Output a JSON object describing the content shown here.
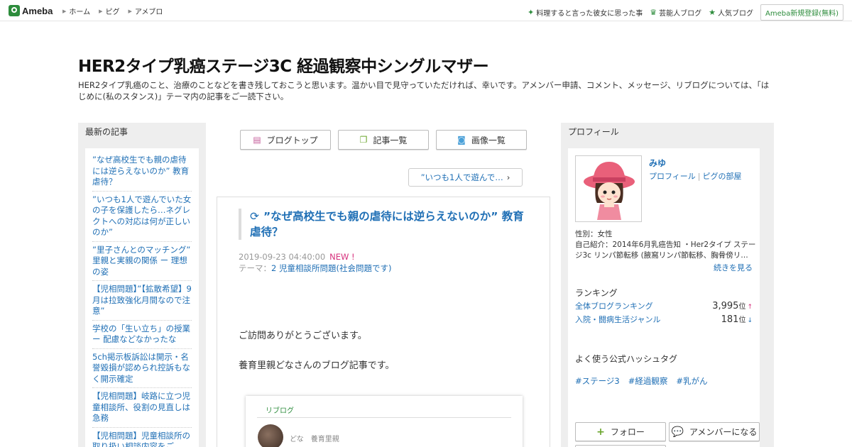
{
  "topbar": {
    "logo": "Ameba",
    "nav": [
      "ホーム",
      "ピグ",
      "アメブロ"
    ],
    "right_links": [
      {
        "icon": "sparkle-icon",
        "label": "料理すると言った彼女に思った事"
      },
      {
        "icon": "crown-icon",
        "label": "芸能人ブログ"
      },
      {
        "icon": "star-icon",
        "label": "人気ブログ"
      }
    ],
    "register": "Ameba新規登録(無料)"
  },
  "header": {
    "title": "HER2タイプ乳癌ステージ3C 経過観察中シングルマザー",
    "description": "HER2タイプ乳癌のこと、治療のことなどを書き残しておこうと思います。温かい目で見守っていただければ、幸いです。アメンバー申請、コメント、メッセージ、リブログについては、「はじめに(私のスタンス)」テーマ内の記事をご一読下さい。"
  },
  "left": {
    "heading": "最新の記事",
    "items": [
      "”なぜ高校生でも親の虐待には逆らえないのか” 教育虐待？",
      "”いつも1人で遊んでいた女の子を保護したら…ネグレクトへの対応は何が正しいのか”",
      "”里子さんとのマッチング” 里親と実親の関係 ー 理想の姿",
      "【児相問題】”【拡散希望】9月は拉致強化月間なので注意”",
      "学校の「生い立ち」の授業 ー 配慮などなかったな",
      "5ch掲示板訴訟は開示・名誉毀損が認められ控訴もなく開示確定",
      "【児相問題】岐路に立つ児童相談所、役割の見直しは急務",
      "【児相問題】児童相談所の取り扱い相談内容をご"
    ]
  },
  "center": {
    "nav_buttons": [
      {
        "icon": "document-icon",
        "label": "ブログトップ"
      },
      {
        "icon": "list-icon",
        "label": "記事一覧"
      },
      {
        "icon": "camera-icon",
        "label": "画像一覧"
      }
    ],
    "next_article": "”いつも1人で遊んで…",
    "article": {
      "title": "”なぜ高校生でも親の虐待には逆らえないのか” 教育虐待？",
      "date": "2019-09-23 04:40:00",
      "new_badge": "NEW !",
      "theme_label": "テーマ：",
      "theme": "2 児童相談所問題(社会問題です)",
      "paragraphs": [
        "ご訪問ありがとうございます。",
        "養育里親どなさんのブログ記事です。"
      ],
      "reblog_label": "リブログ",
      "reblog_author": "どな　養育里親"
    }
  },
  "right": {
    "heading": "プロフィール",
    "name": "みゆ",
    "links": [
      "プロフィール",
      "ピグの部屋"
    ],
    "link_sep": "|",
    "gender": "性別：女性",
    "intro": "自己紹介：2014年6月乳癌告知 ・Her2タイプ ステージ3c リンパ節転移 (腋窩リンパ節転移、胸骨傍リ…",
    "more": "続きを見る",
    "ranking_heading": "ランキング",
    "rankings": [
      {
        "label": "全体ブログランキング",
        "value": "3,995",
        "unit": "位",
        "trend": "↑",
        "trend_color": "#d6307c"
      },
      {
        "label": "入院・闘病生活ジャンル",
        "value": "181",
        "unit": "位",
        "trend": "↓",
        "trend_color": "#1f6fb5"
      }
    ],
    "hashtag_heading": "よく使う公式ハッシュタグ",
    "hashtags": [
      "#ステージ3",
      "#経過観察",
      "#乳がん"
    ],
    "follow": "フォロー",
    "amember": "アメンバーになる"
  },
  "colors": {
    "link": "#1f6fb5",
    "brand": "#2d8c3c",
    "new": "#d6307c"
  }
}
